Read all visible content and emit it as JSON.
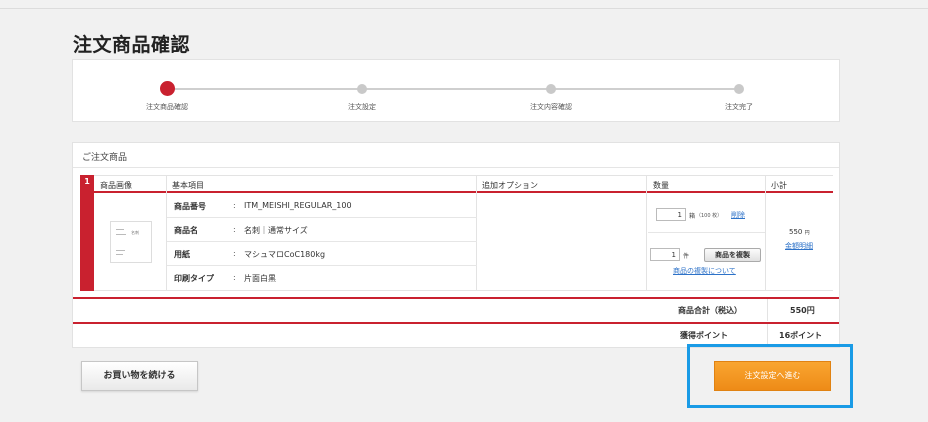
{
  "page_title": "注文商品確認",
  "steps": [
    {
      "label": "注文商品確認",
      "active": true
    },
    {
      "label": "注文設定",
      "active": false
    },
    {
      "label": "注文内容確認",
      "active": false
    },
    {
      "label": "注文完了",
      "active": false
    }
  ],
  "order": {
    "section_title": "ご注文商品",
    "headers": {
      "image": "商品画像",
      "basic": "基本項目",
      "options": "追加オプション",
      "quantity": "数量",
      "subtotal": "小計"
    },
    "item": {
      "number": "1",
      "thumb_text": "名刺",
      "attributes": [
        {
          "key": "商品番号",
          "value": "ITM_MEISHI_REGULAR_100"
        },
        {
          "key": "商品名",
          "value": "名刺｜通常サイズ"
        },
        {
          "key": "用紙",
          "value": "マシュマロCoC180kg"
        },
        {
          "key": "印刷タイプ",
          "value": "片面白黒"
        }
      ],
      "box_qty": "1",
      "box_unit": "箱",
      "box_sheets": "（100 枚）",
      "delete_label": "削除",
      "copy_qty": "1",
      "copy_unit": "件",
      "copy_button": "商品を複製",
      "copy_about_link": "商品の複製について",
      "price": "550",
      "price_unit": "円",
      "price_detail_link": "金額明細"
    },
    "total_label": "商品合計（税込）",
    "total_value": "550円",
    "points_label": "獲得ポイント",
    "points_value": "16ポイント"
  },
  "buttons": {
    "continue_shopping": "お買い物を続ける",
    "proceed": "注文設定へ進む"
  },
  "colors": {
    "accent_red": "#c9212f",
    "proceed_orange": "#f19a24",
    "highlight_blue": "#1a9be6",
    "link_blue": "#2d72c8"
  }
}
